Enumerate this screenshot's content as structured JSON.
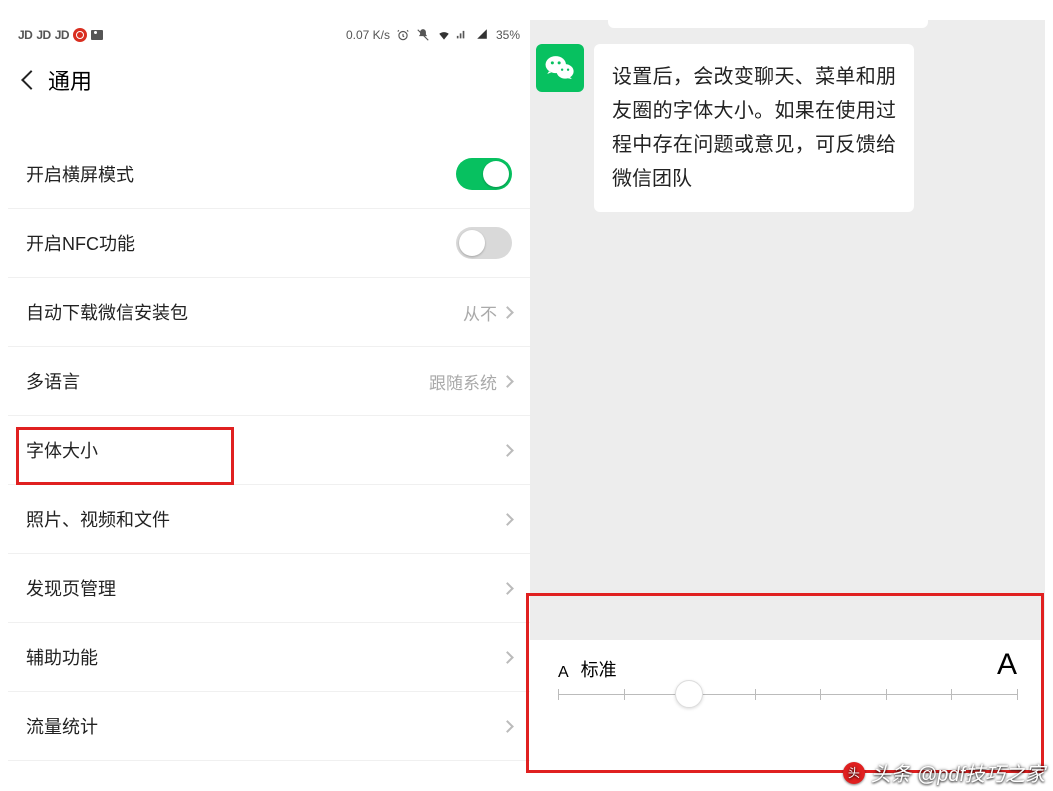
{
  "status": {
    "jd": "JD",
    "speed": "0.07 K/s",
    "battery": "35%"
  },
  "header": {
    "title": "通用"
  },
  "settings": {
    "landscape": {
      "label": "开启横屏模式",
      "on": true
    },
    "nfc": {
      "label": "开启NFC功能",
      "on": false
    },
    "autodl": {
      "label": "自动下载微信安装包",
      "value": "从不"
    },
    "lang": {
      "label": "多语言",
      "value": "跟随系统"
    },
    "fontsize": {
      "label": "字体大小"
    },
    "media": {
      "label": "照片、视频和文件"
    },
    "discover": {
      "label": "发现页管理"
    },
    "access": {
      "label": "辅助功能"
    },
    "traffic": {
      "label": "流量统计"
    }
  },
  "chat": {
    "message": "设置后，会改变聊天、菜单和朋友圈的字体大小。如果在使用过程中存在问题或意见，可反馈给微信团队"
  },
  "slider": {
    "small": "A",
    "std": "标准",
    "big": "A",
    "steps": 8,
    "pos": 1
  },
  "watermark": {
    "prefix": "头条",
    "author": "@pdf技巧之家"
  }
}
